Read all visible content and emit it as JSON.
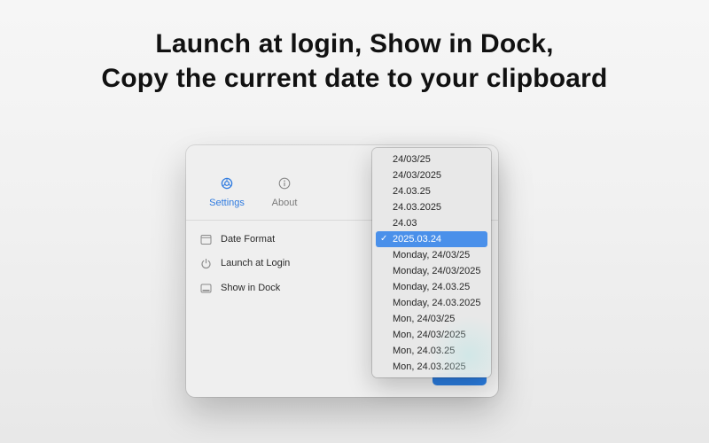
{
  "headline": {
    "line1": "Launch at login, Show in Dock,",
    "line2": "Copy the current date to your clipboard"
  },
  "window": {
    "tabs": [
      {
        "label": "Settings",
        "icon": "gear-icon",
        "active": true
      },
      {
        "label": "About",
        "icon": "info-icon",
        "active": false
      }
    ],
    "settings": [
      {
        "label": "Date Format",
        "icon": "calendar-icon"
      },
      {
        "label": "Launch at Login",
        "icon": "power-icon"
      },
      {
        "label": "Show in Dock",
        "icon": "dock-icon"
      }
    ]
  },
  "dropdown": {
    "options": [
      "24/03/25",
      "24/03/2025",
      "24.03.25",
      "24.03.2025",
      "24.03",
      "2025.03.24",
      "Monday, 24/03/25",
      "Monday, 24/03/2025",
      "Monday, 24.03.25",
      "Monday, 24.03.2025",
      "Mon, 24/03/25",
      "Mon, 24/03/2025",
      "Mon, 24.03.25",
      "Mon, 24.03.2025"
    ],
    "selected_index": 5,
    "check_glyph": "✓"
  },
  "colors": {
    "accent": "#2f7be0",
    "selection": "#4a90ea",
    "button": "#2a7de1"
  }
}
